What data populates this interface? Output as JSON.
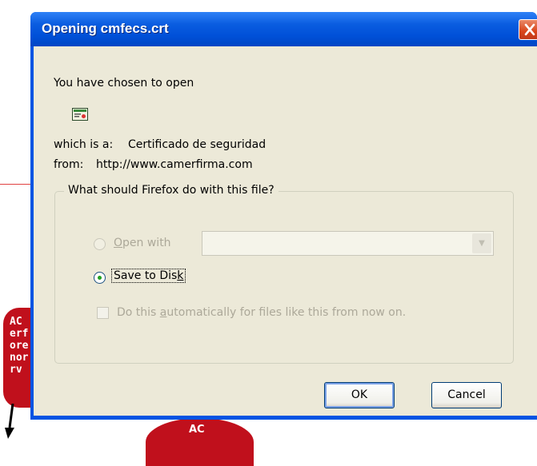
{
  "background": {
    "badge_text": "AC\nerf\nore\nnor\nrv",
    "circle_text": "AC"
  },
  "dialog": {
    "title": "Opening cmfecs.crt",
    "intro": "You have chosen to open",
    "file_icon": "certificate-icon",
    "which_is_label": "which is a:",
    "which_is_value": "Certificado de seguridad",
    "from_label": "from:",
    "from_value": "http://www.camerfirma.com",
    "question": "What should Firefox do with this file?",
    "open_with": {
      "prefix": "",
      "accel": "O",
      "rest": "pen with",
      "enabled": false,
      "selected": false,
      "value": ""
    },
    "save_to_disk": {
      "prefix": "Save to Dis",
      "accel": "k",
      "rest": "",
      "enabled": true,
      "selected": true
    },
    "auto": {
      "prefix": "Do this ",
      "accel": "a",
      "rest": "utomatically for files like this from now on.",
      "enabled": false,
      "checked": false
    },
    "ok_label": "OK",
    "cancel_label": "Cancel"
  }
}
